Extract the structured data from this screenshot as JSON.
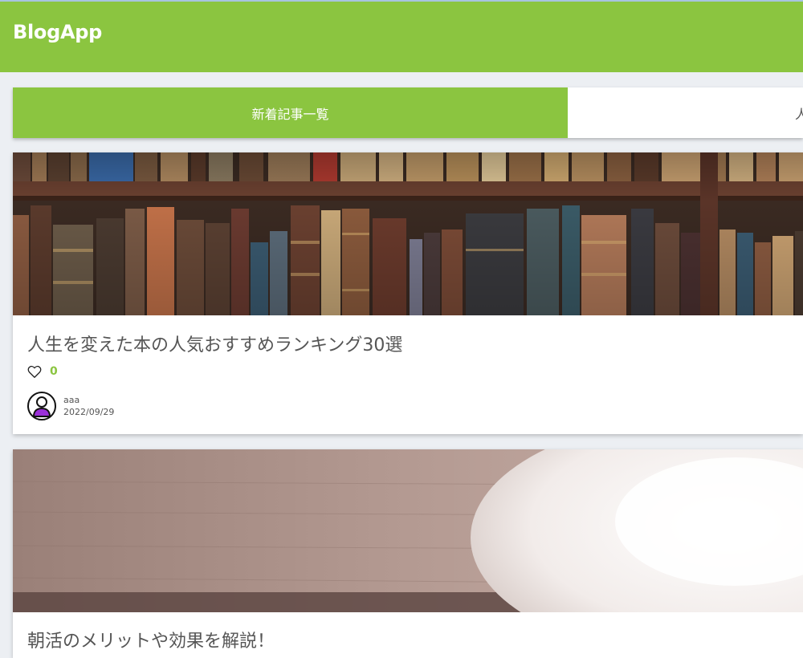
{
  "header": {
    "brand": "BlogApp"
  },
  "tabs": [
    {
      "label": "新着記事一覧",
      "active": true
    },
    {
      "label": "人",
      "active": false
    }
  ],
  "posts": [
    {
      "title": "人生を変えた本の人気おすすめランキング30選",
      "likes": "0",
      "author": "aaa",
      "date": "2022/09/29",
      "image": "bookshelf-photo"
    },
    {
      "title": "朝活のメリットや効果を解説！",
      "image": "coffee-cup-photo"
    }
  ],
  "colors": {
    "accent": "#8bc540",
    "text": "#555555",
    "background": "#eceff3",
    "avatar_purple": "#9b30d9"
  }
}
